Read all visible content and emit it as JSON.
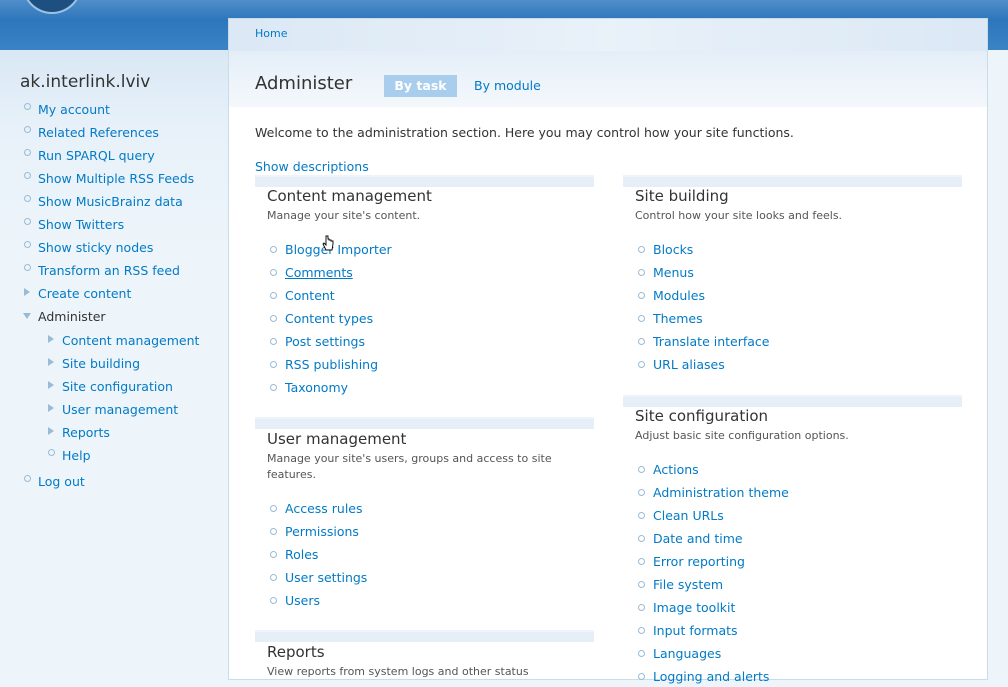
{
  "sidebar": {
    "title": "ak.interlink.lviv",
    "items": [
      {
        "label": "My account",
        "icon": "bullet"
      },
      {
        "label": "Related References",
        "icon": "bullet"
      },
      {
        "label": "Run SPARQL query",
        "icon": "bullet"
      },
      {
        "label": "Show Multiple RSS Feeds",
        "icon": "bullet"
      },
      {
        "label": "Show MusicBrainz data",
        "icon": "bullet"
      },
      {
        "label": "Show Twitters",
        "icon": "bullet"
      },
      {
        "label": "Show sticky nodes",
        "icon": "bullet"
      },
      {
        "label": "Transform an RSS feed",
        "icon": "bullet"
      },
      {
        "label": "Create content",
        "icon": "collapsed"
      },
      {
        "label": "Administer",
        "icon": "expanded"
      },
      {
        "label": "Log out",
        "icon": "bullet"
      }
    ],
    "admin_children": [
      {
        "label": "Content management",
        "icon": "collapsed"
      },
      {
        "label": "Site building",
        "icon": "collapsed"
      },
      {
        "label": "Site configuration",
        "icon": "collapsed"
      },
      {
        "label": "User management",
        "icon": "collapsed"
      },
      {
        "label": "Reports",
        "icon": "collapsed"
      },
      {
        "label": "Help",
        "icon": "bullet"
      }
    ]
  },
  "breadcrumb": {
    "home": "Home"
  },
  "page": {
    "title": "Administer",
    "tabs": [
      {
        "label": "By task",
        "active": true
      },
      {
        "label": "By module",
        "active": false
      }
    ],
    "welcome": "Welcome to the administration section. Here you may control how your site functions.",
    "show_descriptions": "Show descriptions"
  },
  "panels": {
    "content_management": {
      "title": "Content management",
      "desc": "Manage your site's content.",
      "items": [
        "Blogger Importer",
        "Comments",
        "Content",
        "Content types",
        "Post settings",
        "RSS publishing",
        "Taxonomy"
      ]
    },
    "user_management": {
      "title": "User management",
      "desc": "Manage your site's users, groups and access to site features.",
      "items": [
        "Access rules",
        "Permissions",
        "Roles",
        "User settings",
        "Users"
      ]
    },
    "reports": {
      "title": "Reports",
      "desc": "View reports from system logs and other status"
    },
    "site_building": {
      "title": "Site building",
      "desc": "Control how your site looks and feels.",
      "items": [
        "Blocks",
        "Menus",
        "Modules",
        "Themes",
        "Translate interface",
        "URL aliases"
      ]
    },
    "site_configuration": {
      "title": "Site configuration",
      "desc": "Adjust basic site configuration options.",
      "items": [
        "Actions",
        "Administration theme",
        "Clean URLs",
        "Date and time",
        "Error reporting",
        "File system",
        "Image toolkit",
        "Input formats",
        "Languages",
        "Logging and alerts"
      ]
    }
  },
  "colors": {
    "link": "#027ac6",
    "tab_active": "#a9cdec",
    "header": "#2e76bb"
  }
}
